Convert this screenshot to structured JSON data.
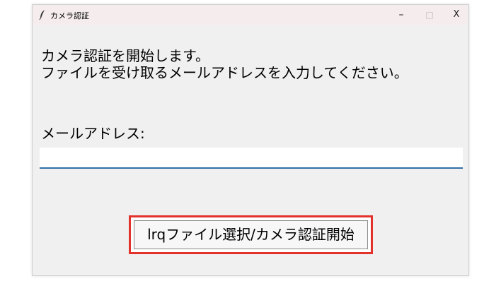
{
  "window": {
    "title": "カメラ認証",
    "controls": {
      "minimize": "–",
      "maximize": "□",
      "close": "X"
    }
  },
  "main": {
    "intro_line1": "カメラ認証を開始します。",
    "intro_line2": "ファイルを受け取るメールアドレスを入力してください。",
    "email_label": "メールアドレス:",
    "email_value": "",
    "start_button_label": "lrqファイル選択/カメラ認証開始"
  },
  "colors": {
    "input_underline": "#2f6fa8",
    "highlight_border": "#e3312b",
    "window_background": "#f0f0f0"
  },
  "icons": {
    "app_icon": "feather-icon"
  }
}
